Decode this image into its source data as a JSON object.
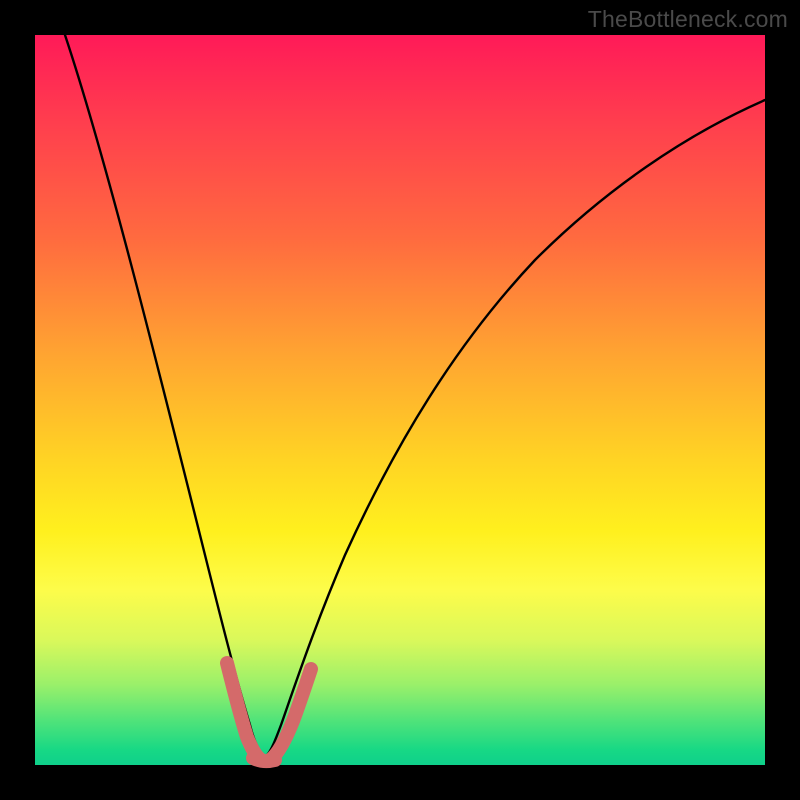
{
  "watermark": "TheBottleneck.com",
  "colors": {
    "frame": "#000000",
    "curve_black": "#000000",
    "curve_accent": "#d46a6a",
    "gradient_stops": [
      "#ff1a58",
      "#ff3e4e",
      "#ff6b3f",
      "#ffa531",
      "#ffd324",
      "#fff01e",
      "#fdfc4a",
      "#d9f85b",
      "#9af06a",
      "#4fe37a",
      "#17d885",
      "#0fd08b"
    ]
  },
  "chart_data": {
    "type": "line",
    "title": "",
    "xlabel": "",
    "ylabel": "",
    "xlim": [
      0,
      100
    ],
    "ylim": [
      0,
      100
    ],
    "grid": false,
    "note": "Values estimated from pixel positions; y measured from bottom (green) upward (red).",
    "series": [
      {
        "name": "black-curve",
        "color": "#000000",
        "x": [
          4,
          6,
          8,
          10,
          12,
          14,
          16,
          18,
          20,
          22,
          24,
          26,
          27,
          28,
          29,
          30,
          31,
          32,
          33,
          34,
          36,
          38,
          40,
          44,
          48,
          52,
          56,
          60,
          64,
          68,
          72,
          76,
          80,
          84,
          88,
          92,
          96,
          100
        ],
        "y": [
          100,
          92,
          84,
          77,
          70,
          62,
          55,
          48,
          40,
          32,
          23,
          14,
          10,
          7,
          4,
          2,
          2,
          3,
          5,
          8,
          14,
          20,
          25,
          34,
          42,
          48,
          53,
          58,
          62,
          65,
          68,
          71,
          73,
          75,
          77,
          78.5,
          80,
          81
        ]
      },
      {
        "name": "accent-valley-band",
        "color": "#d46a6a",
        "x": [
          25.5,
          26.5,
          27.5,
          28.5,
          29.5,
          30.5,
          31.5,
          32.5,
          33.5,
          34.5
        ],
        "y": [
          14,
          10,
          6.5,
          4,
          2.5,
          2.2,
          3,
          5,
          8,
          12
        ]
      }
    ]
  }
}
